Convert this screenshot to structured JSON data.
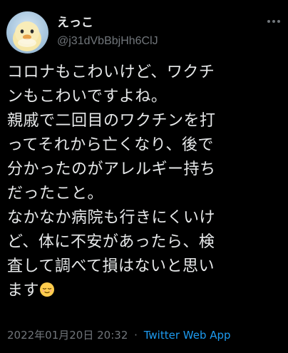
{
  "tweet": {
    "author": {
      "display_name": "えっこ",
      "handle": "@j31dVbBbjHh6ClJ",
      "avatar_icon": "duck-avatar"
    },
    "more_icon": "more-icon",
    "text_lines": [
      "コロナもこわいけど、ワクチ",
      "ンもこわいですよね。",
      "親戚で二回目のワクチンを打",
      "ってそれから亡くなり、後で",
      "分かったのがアレルギー持ち",
      "だったこと。",
      "なかなか病院も行きにくいけ",
      "ど、体に不安があったら、検",
      "査して調べて損はないと思い",
      "ます"
    ],
    "emoji": "relieved-face-emoji",
    "date": "2022年01月20日",
    "time": "20:32",
    "separator": "·",
    "source": "Twitter Web App"
  },
  "colors": {
    "background": "#000000",
    "text": "#e7e9ea",
    "secondary": "#71767b",
    "link": "#1d9bf0"
  }
}
